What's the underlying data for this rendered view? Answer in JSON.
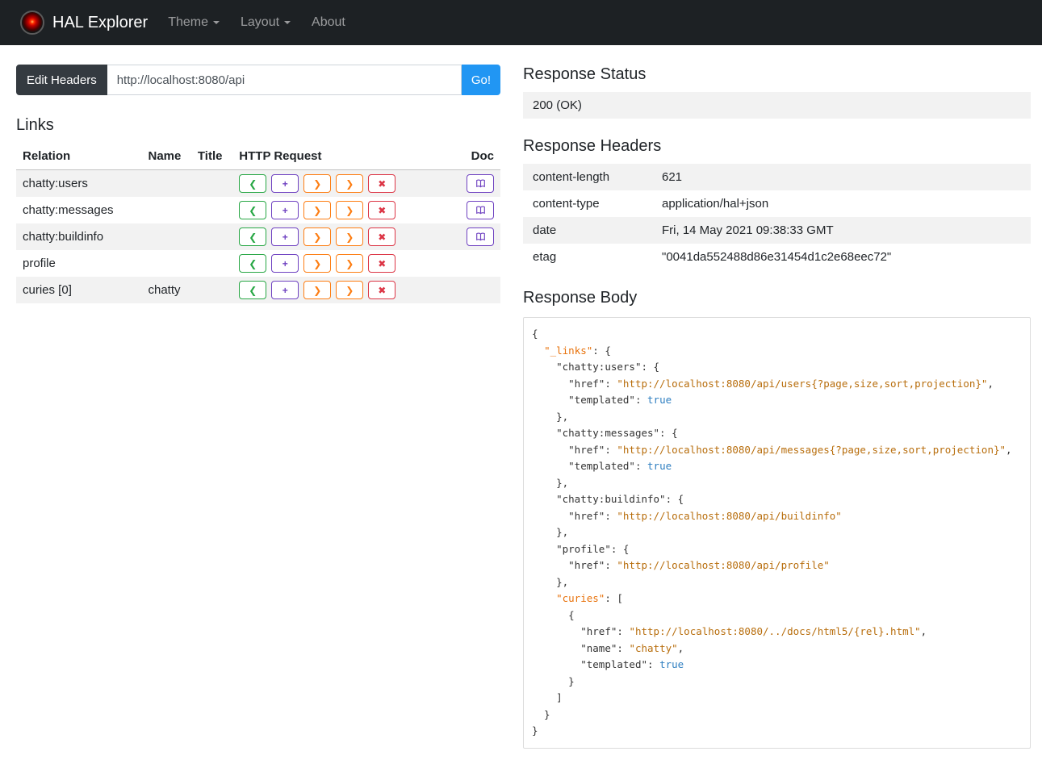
{
  "navbar": {
    "brand": "HAL Explorer",
    "items": [
      {
        "label": "Theme",
        "dropdown": true
      },
      {
        "label": "Layout",
        "dropdown": true
      },
      {
        "label": "About",
        "dropdown": false
      }
    ]
  },
  "toolbar": {
    "edit_headers_label": "Edit Headers",
    "url_value": "http://localhost:8080/api",
    "go_label": "Go!"
  },
  "links": {
    "title": "Links",
    "columns": [
      "Relation",
      "Name",
      "Title",
      "HTTP Request",
      "Doc"
    ],
    "request_buttons": [
      {
        "name": "get-request",
        "glyph": "❮",
        "color_class": "green"
      },
      {
        "name": "post-request",
        "glyph": "+",
        "color_class": "purple"
      },
      {
        "name": "put-request",
        "glyph": "❯",
        "color_class": "orange"
      },
      {
        "name": "patch-request",
        "glyph": "❯",
        "color_class": "orange"
      },
      {
        "name": "delete-request",
        "glyph": "✖",
        "color_class": "red"
      }
    ],
    "rows": [
      {
        "relation": "chatty:users",
        "name": "",
        "title": "",
        "doc": true
      },
      {
        "relation": "chatty:messages",
        "name": "",
        "title": "",
        "doc": true
      },
      {
        "relation": "chatty:buildinfo",
        "name": "",
        "title": "",
        "doc": true
      },
      {
        "relation": "profile",
        "name": "",
        "title": "",
        "doc": false
      },
      {
        "relation": "curies [0]",
        "name": "chatty",
        "title": "",
        "doc": false
      }
    ]
  },
  "response": {
    "status_title": "Response Status",
    "status_value": "200 (OK)",
    "headers_title": "Response Headers",
    "headers": [
      {
        "name": "content-length",
        "value": "621"
      },
      {
        "name": "content-type",
        "value": "application/hal+json"
      },
      {
        "name": "date",
        "value": "Fri, 14 May 2021 09:38:33 GMT"
      },
      {
        "name": "etag",
        "value": "\"0041da552488d86e31454d1c2e68eec72\""
      }
    ],
    "body_title": "Response Body",
    "body_lines": [
      [
        [
          "p",
          "{"
        ]
      ],
      [
        [
          "p",
          "  "
        ],
        [
          "r",
          "\"_links\""
        ],
        [
          "p",
          ": {"
        ]
      ],
      [
        [
          "p",
          "    "
        ],
        [
          "k",
          "\"chatty:users\""
        ],
        [
          "p",
          ": {"
        ]
      ],
      [
        [
          "p",
          "      "
        ],
        [
          "k",
          "\"href\""
        ],
        [
          "p",
          ": "
        ],
        [
          "s",
          "\"http://localhost:8080/api/users{?page,size,sort,projection}\""
        ],
        [
          "p",
          ","
        ]
      ],
      [
        [
          "p",
          "      "
        ],
        [
          "k",
          "\"templated\""
        ],
        [
          "p",
          ": "
        ],
        [
          "b",
          "true"
        ]
      ],
      [
        [
          "p",
          "    },"
        ]
      ],
      [
        [
          "p",
          "    "
        ],
        [
          "k",
          "\"chatty:messages\""
        ],
        [
          "p",
          ": {"
        ]
      ],
      [
        [
          "p",
          "      "
        ],
        [
          "k",
          "\"href\""
        ],
        [
          "p",
          ": "
        ],
        [
          "s",
          "\"http://localhost:8080/api/messages{?page,size,sort,projection}\""
        ],
        [
          "p",
          ","
        ]
      ],
      [
        [
          "p",
          "      "
        ],
        [
          "k",
          "\"templated\""
        ],
        [
          "p",
          ": "
        ],
        [
          "b",
          "true"
        ]
      ],
      [
        [
          "p",
          "    },"
        ]
      ],
      [
        [
          "p",
          "    "
        ],
        [
          "k",
          "\"chatty:buildinfo\""
        ],
        [
          "p",
          ": {"
        ]
      ],
      [
        [
          "p",
          "      "
        ],
        [
          "k",
          "\"href\""
        ],
        [
          "p",
          ": "
        ],
        [
          "s",
          "\"http://localhost:8080/api/buildinfo\""
        ]
      ],
      [
        [
          "p",
          "    },"
        ]
      ],
      [
        [
          "p",
          "    "
        ],
        [
          "k",
          "\"profile\""
        ],
        [
          "p",
          ": {"
        ]
      ],
      [
        [
          "p",
          "      "
        ],
        [
          "k",
          "\"href\""
        ],
        [
          "p",
          ": "
        ],
        [
          "s",
          "\"http://localhost:8080/api/profile\""
        ]
      ],
      [
        [
          "p",
          "    },"
        ]
      ],
      [
        [
          "p",
          "    "
        ],
        [
          "r",
          "\"curies\""
        ],
        [
          "p",
          ": ["
        ]
      ],
      [
        [
          "p",
          "      {"
        ]
      ],
      [
        [
          "p",
          "        "
        ],
        [
          "k",
          "\"href\""
        ],
        [
          "p",
          ": "
        ],
        [
          "s",
          "\"http://localhost:8080/../docs/html5/{rel}.html\""
        ],
        [
          "p",
          ","
        ]
      ],
      [
        [
          "p",
          "        "
        ],
        [
          "k",
          "\"name\""
        ],
        [
          "p",
          ": "
        ],
        [
          "s",
          "\"chatty\""
        ],
        [
          "p",
          ","
        ]
      ],
      [
        [
          "p",
          "        "
        ],
        [
          "k",
          "\"templated\""
        ],
        [
          "p",
          ": "
        ],
        [
          "b",
          "true"
        ]
      ],
      [
        [
          "p",
          "      }"
        ]
      ],
      [
        [
          "p",
          "    ]"
        ]
      ],
      [
        [
          "p",
          "  }"
        ]
      ],
      [
        [
          "p",
          "}"
        ]
      ]
    ]
  },
  "colors": {
    "navbar_bg": "#1d2124",
    "go_button_blue": "#2196f3",
    "edit_headers_dark": "#343a40",
    "get_green": "#28a745",
    "post_purple": "#6f42c1",
    "put_patch_orange": "#fd7e14",
    "delete_red": "#dc3545",
    "stripe_gray": "#f2f2f2",
    "json_key_special_orange": "#e8710a",
    "json_string_orange": "#b86e0d",
    "json_boolean_blue": "#2f7fc1"
  }
}
